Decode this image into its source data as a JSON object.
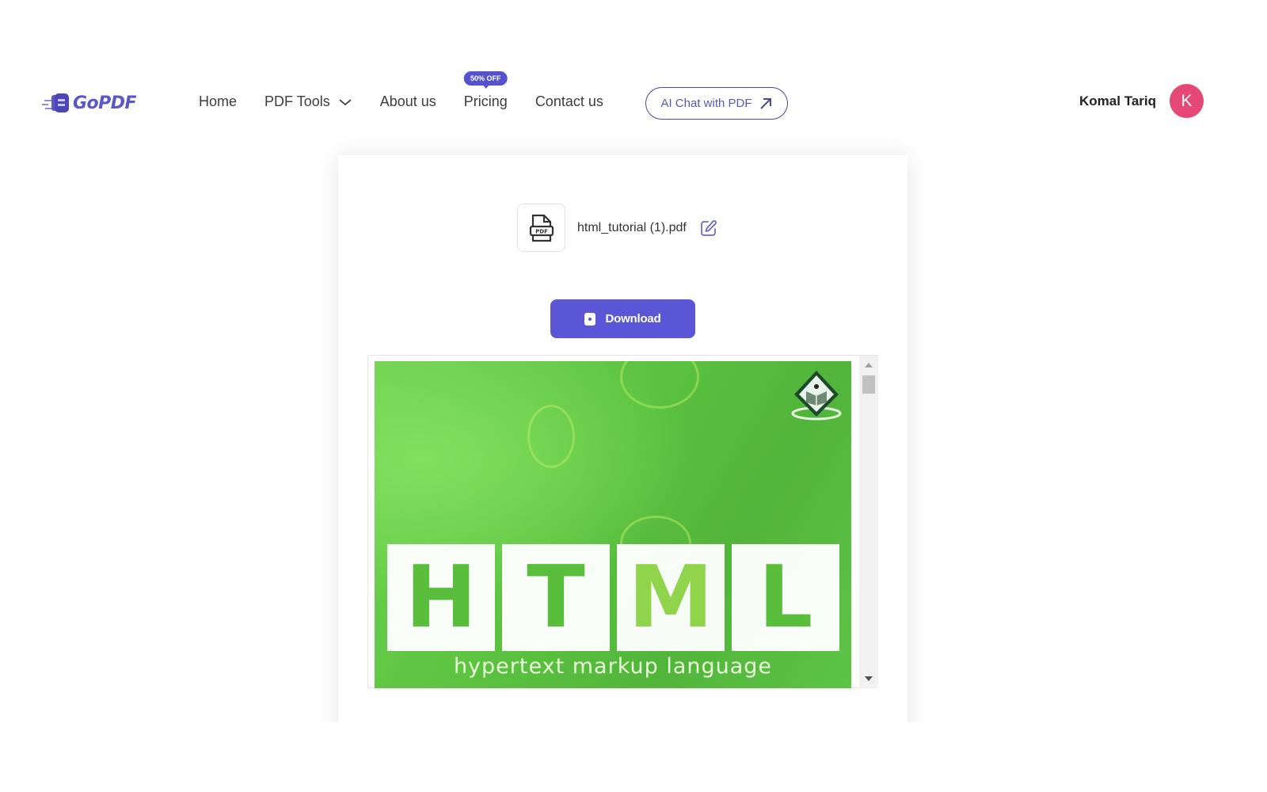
{
  "brand": {
    "name": "GoPDF",
    "color": "#5a57c9"
  },
  "nav": {
    "items": [
      {
        "label": "Home"
      },
      {
        "label": "PDF Tools",
        "has_dropdown": true
      },
      {
        "label": "About us"
      },
      {
        "label": "Pricing",
        "badge": "50% OFF"
      },
      {
        "label": "Contact us"
      }
    ],
    "ai_chat_label": "AI Chat with PDF",
    "ai_chat_icon": "arrow-up-right-icon"
  },
  "user": {
    "name": "Komal Tariq",
    "avatar_initial": "K",
    "avatar_color": "#e54874"
  },
  "file": {
    "name": "html_tutorial (1).pdf",
    "icon": "pdf-file-icon",
    "edit_icon": "edit-icon"
  },
  "download": {
    "label": "Download",
    "color": "#5a56d6"
  },
  "preview": {
    "page_letters": [
      "H",
      "T",
      "M",
      "L"
    ],
    "page_tagline": "hypertext markup language"
  }
}
